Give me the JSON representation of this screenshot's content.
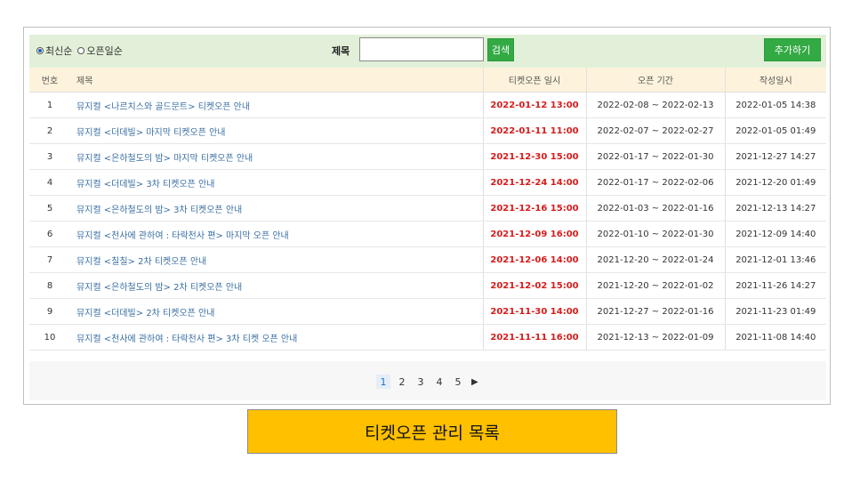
{
  "filters": {
    "sort_latest": "최신순",
    "sort_open_date": "오픈일순",
    "title_label": "제목",
    "title_value": "",
    "search_label": "검색",
    "add_label": "추가하기"
  },
  "table": {
    "headers": [
      "번호",
      "제목",
      "티켓오픈 일시",
      "오픈 기간",
      "작성일시"
    ],
    "rows": [
      {
        "no": "1",
        "title": "뮤지컬 <나르치스와 골드문트> 티켓오픈 안내",
        "open": "2022-01-12 13:00",
        "period": "2022-02-08 ~ 2022-02-13",
        "created": "2022-01-05 14:38"
      },
      {
        "no": "2",
        "title": "뮤지컬 <더데빌> 마지막 티켓오픈 안내",
        "open": "2022-01-11 11:00",
        "period": "2022-02-07 ~ 2022-02-27",
        "created": "2022-01-05 01:49"
      },
      {
        "no": "3",
        "title": "뮤지컬 <은하철도의 밤> 마지막 티켓오픈 안내",
        "open": "2021-12-30 15:00",
        "period": "2022-01-17 ~ 2022-01-30",
        "created": "2021-12-27 14:27"
      },
      {
        "no": "4",
        "title": "뮤지컬 <더데빌> 3차 티켓오픈 안내",
        "open": "2021-12-24 14:00",
        "period": "2022-01-17 ~ 2022-02-06",
        "created": "2021-12-20 01:49"
      },
      {
        "no": "5",
        "title": "뮤지컬 <은하철도의 밤> 3차 티켓오픈 안내",
        "open": "2021-12-16 15:00",
        "period": "2022-01-03 ~ 2022-01-16",
        "created": "2021-12-13 14:27"
      },
      {
        "no": "6",
        "title": "뮤지컬 <천사에 관하여 : 타락천사 편> 마지막 오픈 안내",
        "open": "2021-12-09 16:00",
        "period": "2022-01-10 ~ 2022-01-30",
        "created": "2021-12-09 14:40"
      },
      {
        "no": "7",
        "title": "뮤지컬 <칠칠> 2차 티켓오픈 안내",
        "open": "2021-12-06 14:00",
        "period": "2021-12-20 ~ 2022-01-24",
        "created": "2021-12-01 13:46"
      },
      {
        "no": "8",
        "title": "뮤지컬 <은하철도의 밤> 2차 티켓오픈 안내",
        "open": "2021-12-02 15:00",
        "period": "2021-12-20 ~ 2022-01-02",
        "created": "2021-11-26 14:27"
      },
      {
        "no": "9",
        "title": "뮤지컬 <더데빌> 2차 티켓오픈 안내",
        "open": "2021-11-30 14:00",
        "period": "2021-12-27 ~ 2022-01-16",
        "created": "2021-11-23 01:49"
      },
      {
        "no": "10",
        "title": "뮤지컬 <천사에 관하여 : 타락천사 편> 3차 티켓 오픈 안내",
        "open": "2021-11-11 16:00",
        "period": "2021-12-13 ~ 2022-01-09",
        "created": "2021-11-08 14:40"
      }
    ]
  },
  "pagination": {
    "pages": [
      "1",
      "2",
      "3",
      "4",
      "5"
    ],
    "active": "1",
    "next_icon": "play-triangle-icon"
  },
  "caption": "티켓오픈 관리 목록",
  "colors": {
    "filter_bg": "#e2f0d9",
    "button_green": "#33aa44",
    "header_bg": "#fdf3dc",
    "open_date_red": "#d81b1b",
    "link_blue": "#3a6fa3",
    "caption_bg": "#ffc000"
  }
}
